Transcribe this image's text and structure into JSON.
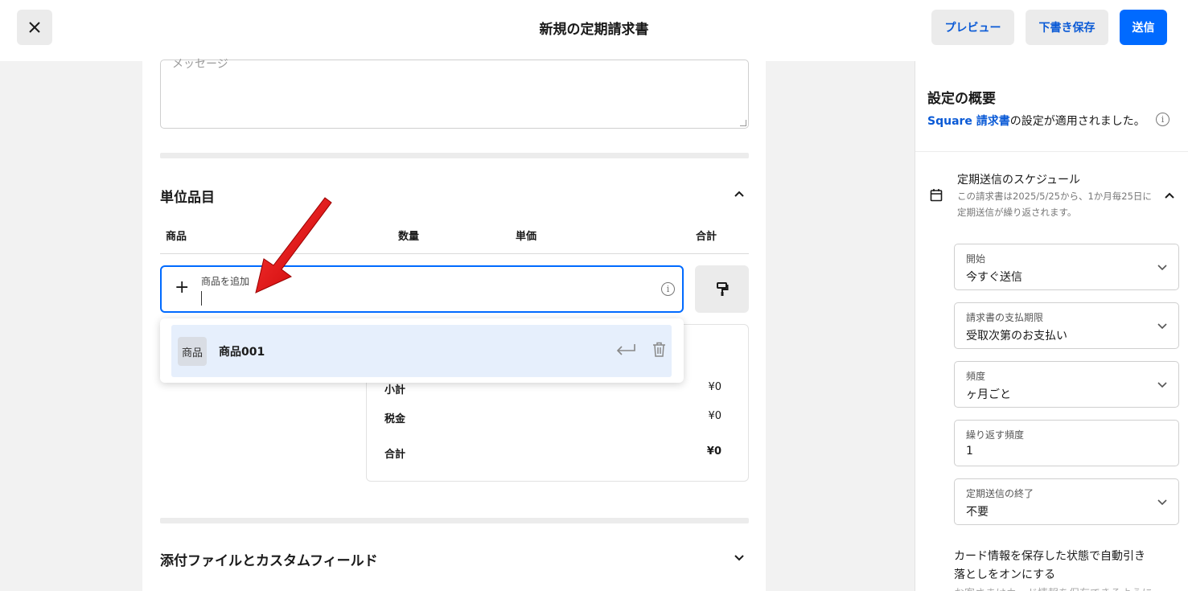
{
  "header": {
    "title": "新規の定期請求書",
    "preview_label": "プレビュー",
    "draft_label": "下書き保存",
    "send_label": "送信",
    "accent": "#006aff"
  },
  "message": {
    "placeholder": "メッセージ"
  },
  "line_items": {
    "section_title": "単位品目",
    "columns": [
      "商品",
      "数量",
      "単価",
      "合計"
    ],
    "add_item_label": "商品を追加"
  },
  "dropdown": {
    "items": [
      {
        "badge": "商品",
        "name": "商品001"
      }
    ]
  },
  "totals": {
    "subtotal_label": "小計",
    "subtotal_value": "¥0",
    "tax_label": "税金",
    "tax_value": "¥0",
    "total_label": "合計",
    "total_value": "¥0"
  },
  "attachments": {
    "section_title": "添付ファイルとカスタムフィールド"
  },
  "settings": {
    "title": "設定の概要",
    "applied_link": "Square 請求書",
    "applied_text": "の設定が適用されました。",
    "schedule_title": "定期送信のスケジュール",
    "schedule_desc": "この請求書は2025/5/25から、1か月毎25日に定期送信が繰り返されます。",
    "fields": [
      {
        "label": "開始",
        "value": "今すぐ送信",
        "dropdown": true
      },
      {
        "label": "請求書の支払期限",
        "value": "受取次第のお支払い",
        "dropdown": true
      },
      {
        "label": "頻度",
        "value": "ヶ月ごと",
        "dropdown": true
      },
      {
        "label": "繰り返す頻度",
        "value": "1",
        "dropdown": false
      },
      {
        "label": "定期送信の終了",
        "value": "不要",
        "dropdown": true
      }
    ],
    "autopay_text": "カード情報を保存した状態で自動引き落としをオンにする",
    "cut_text": "お客さまはカード情報を保存できるように"
  }
}
